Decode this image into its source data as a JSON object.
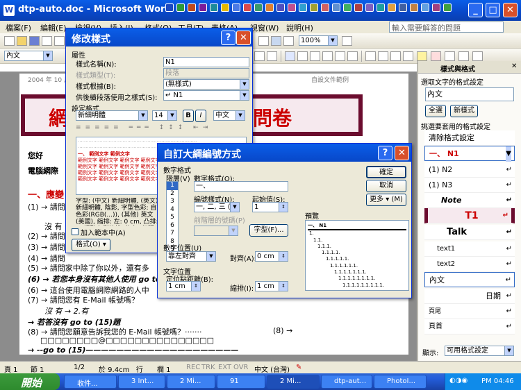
{
  "window": {
    "title": "dtp-auto.doc - Microsoft Word",
    "icon": "W"
  },
  "menu": {
    "items": [
      "檔案(F)",
      "編輯(E)",
      "檢視(V)",
      "插入(I)",
      "格式(O)",
      "工具(T)",
      "表格(A)",
      "視窗(W)",
      "說明(H)"
    ],
    "help_placeholder": "輸入需要解答的問題"
  },
  "toolbar": {
    "zoom": "100%",
    "style": "內文"
  },
  "doc": {
    "header_left": "2004 年 10 月",
    "header_right": "自設文件範例",
    "banner_left": "網",
    "banner_right": "究問卷",
    "lines": [
      "您好",
      "電腦網際",
      "一、應變",
      "(1) → 請問",
      "沒 有",
      "(2) → 請問",
      "(3) → 請問",
      "(4) → 請問",
      "(5) → 請問家中除了你以外，還有多",
      "(6) → 若您本身沒有其他人使用 go to",
      "(6) → 這台使用電腦網際網路的人中",
      "(7) → 請問您有 E-Mail 帳號嗎？",
      "沒 有  →  2.有",
      "→ 若答沒有 go to (15)題",
      "(8) → 請問您願意告訴我您的 E-Mail 帳號嗎？·······",
      "□□□□□□□□@□□□□□□□□□□□□□□□",
      "→ --go to (15)————————————————————"
    ],
    "side_note": "(8) →"
  },
  "modify_style": {
    "title": "修改樣式",
    "section_attr": "屬性",
    "label_name": "樣式名稱(N):",
    "value_name": "N1",
    "label_type": "樣式類型(T):",
    "value_type": "段落",
    "label_base": "樣式根據(B):",
    "value_base": "(無樣式)",
    "label_next": "供後續段落使用之樣式(S):",
    "value_next": "↵ N1",
    "section_format": "設定格式",
    "font": "新細明體",
    "size": "14",
    "lang": "中文",
    "bold": "B",
    "italic": "I",
    "preview_prefix": "一、 範例文字 範例文字",
    "preview_line": "範例文字 範例文字 範例文字 範例文字",
    "desc": "字型: (中文) 新細明體, (英文) 新細明體, 陰影, 字型色彩: 自訂色彩(RGB(...)), (其他) 英文 (美國), 縮排: 左: 0 cm, 凸排: ... 調整右側縮排, 靠左, 行距: 單行...",
    "add_template": "加入範本中(A)",
    "format_btn": "格式(O) ▾"
  },
  "outline_dialog": {
    "title": "自訂大綱編號方式",
    "section_numfmt": "數字格式",
    "label_level": "階層(V)",
    "levels": [
      "1",
      "2",
      "3",
      "4",
      "5",
      "6",
      "7",
      "8",
      "9"
    ],
    "label_numfmt": "數字格式(O):",
    "value_numfmt": "一、",
    "label_style": "編號樣式(N):",
    "value_style": "一, 二, 三 (傳",
    "label_start": "起始值(S):",
    "value_start": "1",
    "label_prev": "前階層的號碼(P)",
    "font_btn": "字型(F)...",
    "label_preview": "預覽",
    "preview_top": "一、 N1",
    "preview_items": [
      "1.",
      "1.1.",
      "1.1.1.",
      "1.1.1.1.",
      "1.1.1.1.1.",
      "1.1.1.1.1.1.",
      "1.1.1.1.1.1.1.",
      "1.1.1.1.1.1.1.1.",
      "1.1.1.1.1.1.1.1.1."
    ],
    "section_numpos": "數字位置(U)",
    "value_align": "靠左對齊",
    "label_align_at": "對齊(A):",
    "value_align_at": "0 cm",
    "section_textpos": "文字位置",
    "label_tab": "定位點距離(B):",
    "value_tab": "1 cm",
    "label_indent": "縮排(I):",
    "value_indent": "1 cm",
    "ok": "確定",
    "cancel": "取消",
    "more": "更多 ▾ (M)"
  },
  "taskpane": {
    "title": "樣式與格式",
    "selected_label": "選取文字的格式設定",
    "selected_value": "內文",
    "select_all": "全選",
    "new_style": "新樣式",
    "pick_label": "挑選要套用的格式設定",
    "items": [
      "清除格式設定",
      "一、  N1",
      "(1)  N2",
      "(1)  N3",
      "Note",
      "T1",
      "Talk",
      "text1",
      "text2",
      "內文",
      "日期",
      "頁尾",
      "頁首"
    ],
    "show_label": "顯示:",
    "show_value": "可用格式設定"
  },
  "status": {
    "page": "頁 1",
    "sec": "節 1",
    "pages": "1/2",
    "at": "於 9.4cm",
    "line": "行",
    "col": "欄 1",
    "flags": [
      "REC",
      "TRK",
      "EXT",
      "OVR"
    ],
    "lang": "中文 (台灣)"
  },
  "taskbar": {
    "start": "開始",
    "buttons": [
      "收件...",
      "3 Int...",
      "2 Mi...",
      "91",
      "2 Mi...",
      "dtp-aut...",
      "PhotoI..."
    ],
    "clock": "PM 04:46"
  },
  "colors": {
    "title_blue": "#0a5ee8",
    "dialog_red_x": "#d8502a",
    "banner_border": "#6b0c2e",
    "accent_red": "#cc0000"
  }
}
